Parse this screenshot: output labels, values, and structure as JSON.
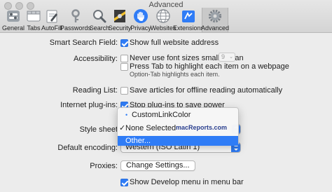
{
  "window": {
    "title": "Advanced"
  },
  "toolbar": {
    "tabs": [
      {
        "label": "General",
        "icon": "gear-switch-icon"
      },
      {
        "label": "Tabs",
        "icon": "tabs-icon"
      },
      {
        "label": "AutoFill",
        "icon": "autofill-icon"
      },
      {
        "label": "Passwords",
        "icon": "key-icon"
      },
      {
        "label": "Search",
        "icon": "search-icon"
      },
      {
        "label": "Security",
        "icon": "security-icon"
      },
      {
        "label": "Privacy",
        "icon": "privacy-hand-icon"
      },
      {
        "label": "Websites",
        "icon": "globe-icon"
      },
      {
        "label": "Extensions",
        "icon": "extensions-icon"
      },
      {
        "label": "Advanced",
        "icon": "gear-icon"
      }
    ],
    "active_tab": "Advanced"
  },
  "settings": {
    "smart_search": {
      "label": "Smart Search Field:",
      "option": "Show full website address",
      "checked": true
    },
    "accessibility": {
      "label": "Accessibility:",
      "opt1": "Never use font sizes smaller than",
      "opt1_checked": false,
      "min_font": "9",
      "opt2": "Press Tab to highlight each item on a webpage",
      "opt2_checked": false,
      "hint": "Option-Tab highlights each item."
    },
    "reading_list": {
      "label": "Reading List:",
      "option": "Save articles for offline reading automatically",
      "checked": false
    },
    "plugins": {
      "label": "Internet plug-ins:",
      "option": "Stop plug-ins to save power",
      "checked": true
    },
    "style_sheet": {
      "label": "Style sheet"
    },
    "encoding": {
      "label": "Default encoding:",
      "value": "Western (ISO Latin 1)"
    },
    "proxies": {
      "label": "Proxies:",
      "button": "Change Settings..."
    },
    "develop": {
      "option": "Show Develop menu in menu bar",
      "checked": true
    }
  },
  "style_menu": {
    "items": [
      {
        "label": "CustomLinkColor",
        "marker": "•"
      },
      {
        "label": "None Selected",
        "marker": "✓"
      },
      {
        "label": "Other...",
        "marker": ""
      }
    ],
    "highlighted": "Other..."
  },
  "watermark": "macReports.com",
  "colors": {
    "accent": "#2f7cf6",
    "window_bg": "#ececec",
    "toolbar_bg": "#d4d4d4"
  }
}
